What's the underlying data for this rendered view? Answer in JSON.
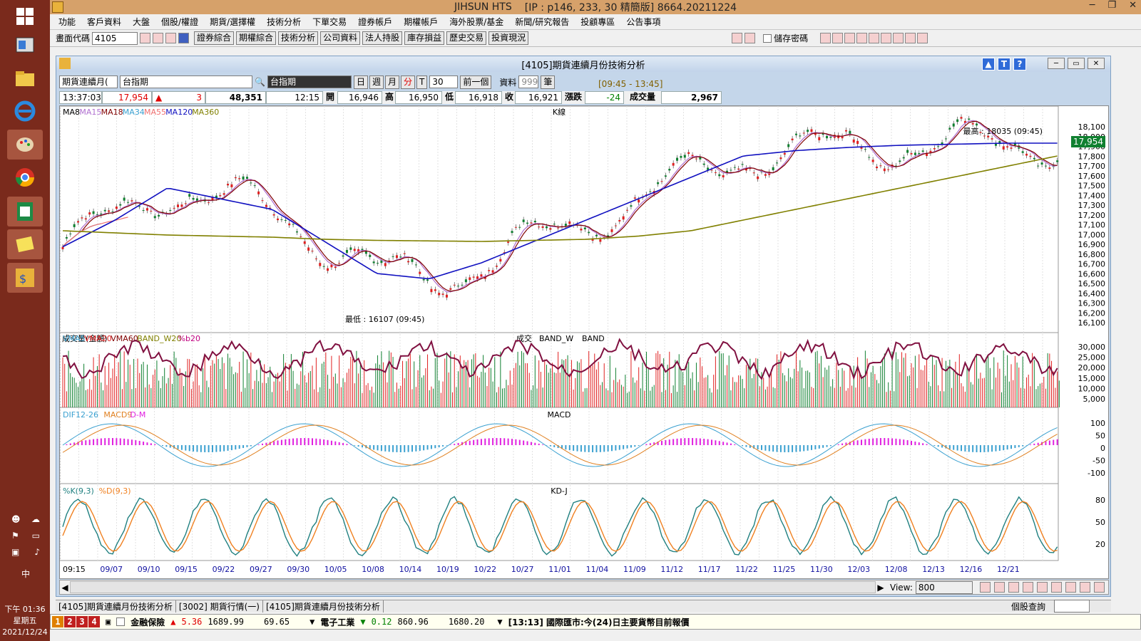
{
  "window": {
    "title": "JIHSUN HTS",
    "subtitle": "[IP : p146, 233, 30 精簡版] 8664.20211224"
  },
  "menu": [
    "功能",
    "客戶資料",
    "大盤",
    "個股/權證",
    "期貨/選擇權",
    "技術分析",
    "下單交易",
    "證券帳戶",
    "期權帳戶",
    "海外股票/基金",
    "新聞/研究報告",
    "投顧專區",
    "公告事項"
  ],
  "toolbar": {
    "code_label": "畫面代碼",
    "code_value": "4105",
    "buttons": [
      "證券綜合",
      "期權綜合",
      "技術分析",
      "公司資料",
      "法人持股",
      "庫存損益",
      "歷史交易",
      "投資現況"
    ],
    "save_password": "儲存密碼"
  },
  "inner": {
    "title": "[4105]期貨連續月份技術分析"
  },
  "controls": {
    "product": "期貨連續月(",
    "symbol": "台指期",
    "name_display": "台指期",
    "periods": [
      "日",
      "週",
      "月",
      "分",
      "T"
    ],
    "interval": "30",
    "prev": "前一個",
    "data_label": "資料",
    "data_count": "999",
    "unit": "筆",
    "session": "[09:45 - 13:45]"
  },
  "info": {
    "time": "13:37:03",
    "price": "17,954",
    "change": "3",
    "volume_total": "48,351",
    "bar_time": "12:15",
    "open_lbl": "開",
    "open": "16,946",
    "high_lbl": "高",
    "high": "16,950",
    "low_lbl": "低",
    "low": "16,918",
    "close_lbl": "收",
    "close": "16,921",
    "chg_lbl": "漲跌",
    "chg": "-24",
    "vol_lbl": "成交量",
    "vol": "2,967"
  },
  "panels": {
    "kline": {
      "title": "K線",
      "legend": [
        {
          "name": "MA8",
          "color": "#000000"
        },
        {
          "name": "MA15",
          "color": "#b070d0"
        },
        {
          "name": "MA18",
          "color": "#800000"
        },
        {
          "name": "MA34",
          "color": "#3aa0d0"
        },
        {
          "name": "MA55",
          "color": "#f07070"
        },
        {
          "name": "MA120",
          "color": "#1010c0"
        },
        {
          "name": "MA360",
          "color": "#808000"
        }
      ],
      "high_note": "最高 : 18035 (09:45)",
      "low_note": "最低 : 16107 (09:45)",
      "last_price": "17,954",
      "yticks": [
        "18,100",
        "18,000",
        "17,900",
        "17,800",
        "17,700",
        "17,600",
        "17,500",
        "17,400",
        "17,300",
        "17,200",
        "17,100",
        "17,000",
        "16,900",
        "16,800",
        "16,700",
        "16,600",
        "16,500",
        "16,400",
        "16,300",
        "16,200",
        "16,100"
      ]
    },
    "volume": {
      "title_left": "成交量(金額)",
      "legend": [
        {
          "name": "VMA5",
          "color": "#3aa0d0"
        },
        {
          "name": "VMA20",
          "color": "#e02020"
        },
        {
          "name": "VMA60",
          "color": "#800000"
        },
        {
          "name": "BAND_W20",
          "color": "#808000"
        },
        {
          "name": "%b20",
          "color": "#c00080"
        }
      ],
      "center": [
        "成交",
        "BAND_W",
        "BAND"
      ],
      "yticks": [
        "30,000",
        "25,000",
        "20,000",
        "15,000",
        "10,000",
        "5,000"
      ]
    },
    "macd": {
      "title": "MACD",
      "legend": [
        {
          "name": "DIF12-26",
          "color": "#3aa0d0"
        },
        {
          "name": "MACD9",
          "color": "#e08020"
        },
        {
          "name": "D-M",
          "color": "#e020e0"
        }
      ],
      "yticks": [
        "100",
        "50",
        "0",
        "-50",
        "-100"
      ]
    },
    "kd": {
      "title": "KD-J",
      "legend": [
        {
          "name": "%K(9,3)",
          "color": "#208080"
        },
        {
          "name": "%D(9,3)",
          "color": "#f08020"
        }
      ],
      "yticks": [
        "80",
        "50",
        "20"
      ]
    }
  },
  "xaxis": [
    "09:15",
    "09/07",
    "09/10",
    "09/15",
    "09/22",
    "09/27",
    "09/30",
    "10/05",
    "10/08",
    "10/14",
    "10/19",
    "10/22",
    "10/27",
    "11/01",
    "11/04",
    "11/09",
    "11/12",
    "11/17",
    "11/22",
    "11/25",
    "11/30",
    "12/03",
    "12/08",
    "12/13",
    "12/16",
    "12/21"
  ],
  "scroll": {
    "view_label": "View:",
    "view_value": "800"
  },
  "tabs": [
    "[4105]期貨連續月份技術分析",
    "[3002] 期貨行情(一)",
    "[4105]期貨連續月份技術分析"
  ],
  "footer": {
    "stock_query": "個股查詢"
  },
  "ticker": {
    "n1": "1",
    "n2": "2",
    "n3": "3",
    "n4": "4",
    "item1": "金融保險",
    "v1": "5.36",
    "p1": "1689.99",
    "c1": "69.65",
    "item2": "電子工業",
    "v2": "0.12",
    "p2": "860.96",
    "c2": "1680.20",
    "news": "[13:13] 國際匯市:今(24)日主要貨幣目前報價"
  },
  "taskbar": {
    "time": "下午 01:36",
    "weekday": "星期五",
    "date": "2021/12/24",
    "ime": "中"
  },
  "chart_data": {
    "type": "line",
    "title": "K線",
    "series": [
      {
        "name": "MA360",
        "values": [
          17000,
          16980,
          16960,
          16950,
          16940,
          16920,
          16910,
          16905,
          16900,
          16910,
          16920,
          16950,
          17000,
          17100,
          17200,
          17300,
          17400,
          17500,
          17600,
          17700
        ]
      },
      {
        "name": "MA120",
        "values": [
          16850,
          17100,
          17400,
          17300,
          17200,
          16900,
          16600,
          16550,
          16700,
          16900,
          17100,
          17300,
          17500,
          17700,
          17750,
          17780,
          17800,
          17810,
          17820,
          17820
        ]
      }
    ],
    "x": [
      "09/07",
      "09/15",
      "09/22",
      "09/30",
      "10/05",
      "10/08",
      "10/14",
      "10/19",
      "10/27",
      "11/01",
      "11/04",
      "11/09",
      "11/17",
      "11/22",
      "11/25",
      "11/30",
      "12/08",
      "12/13",
      "12/16",
      "12/21"
    ],
    "ylim": [
      16100,
      18100
    ]
  }
}
